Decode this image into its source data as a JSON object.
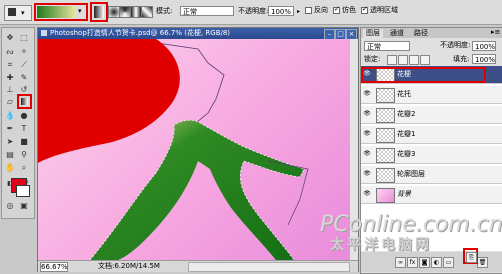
{
  "optionbar": {
    "mode_label": "模式:",
    "mode_value": "正常",
    "opacity_label": "不透明度:",
    "opacity_value": "100%",
    "reverse_label": "反向",
    "dither_label": "仿色",
    "transparency_label": "透明区域"
  },
  "document": {
    "title": "Photoshop打造情人节贺卡.psd@ 66.7% (花梗, RGB/8)",
    "zoom": "66.67%",
    "info": "文档:6.20M/14.5M"
  },
  "panel": {
    "tabs": [
      "图层",
      "通道",
      "路径"
    ],
    "blend_mode": "正常",
    "opacity_label": "不透明度:",
    "opacity_value": "100%",
    "lock_label": "锁定:",
    "fill_label": "填充:",
    "fill_value": "100%",
    "layers": [
      "花梗",
      "花托",
      "花瓣2",
      "花瓣1",
      "花瓣3",
      "轮廓图层",
      "背景"
    ]
  },
  "colors": {
    "foreground": "#e0001a",
    "background": "#ffffff",
    "highlight": "#e00000",
    "selected_layer": "#3d4f86"
  },
  "watermark": {
    "text": "PConline.com.cn",
    "text2": "太平洋电脑网"
  }
}
